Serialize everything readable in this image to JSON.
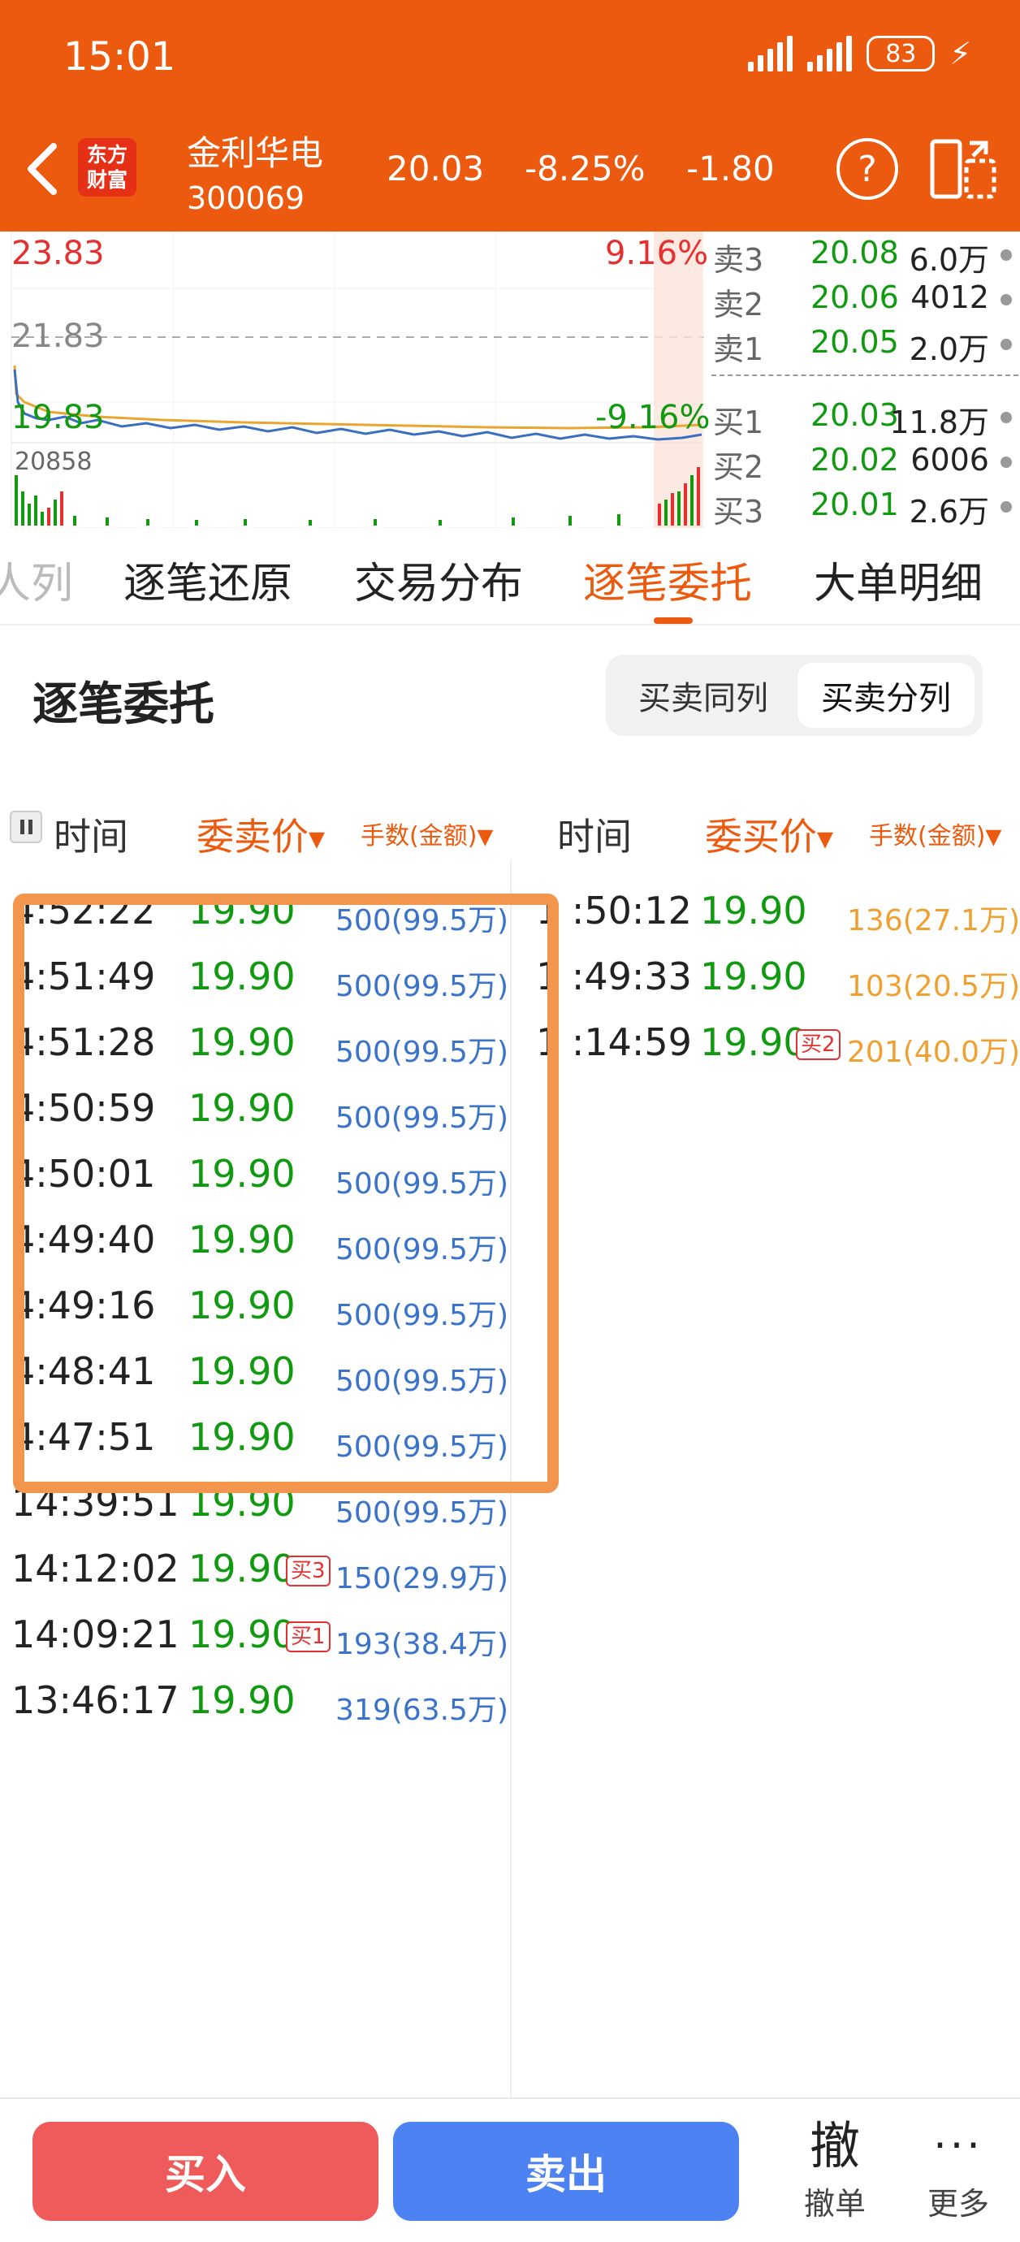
{
  "status_bar": {
    "time": "15:01",
    "battery": "83"
  },
  "header": {
    "logo_line1": "东方",
    "logo_line2": "财富",
    "stock_name": "金利华电",
    "stock_code": "300069",
    "price": "20.03",
    "change_pct": "-8.25%",
    "change": "-1.80",
    "help_label": "?"
  },
  "chart": {
    "high_label": "23.83",
    "mid_label": "21.83",
    "low_label": "19.83",
    "volume_label": "20858",
    "up_pct": "9.16%",
    "down_pct": "-9.16%"
  },
  "order_book": {
    "asks": [
      {
        "label": "卖3",
        "price": "20.08",
        "vol": "6.0万"
      },
      {
        "label": "卖2",
        "price": "20.06",
        "vol": "4012"
      },
      {
        "label": "卖1",
        "price": "20.05",
        "vol": "2.0万"
      }
    ],
    "bids": [
      {
        "label": "买1",
        "price": "20.03",
        "vol": "11.8万"
      },
      {
        "label": "买2",
        "price": "20.02",
        "vol": "6006"
      },
      {
        "label": "买3",
        "price": "20.01",
        "vol": "2.6万"
      }
    ]
  },
  "tabs": [
    "人列",
    "逐笔还原",
    "交易分布",
    "逐笔委托",
    "大单明细"
  ],
  "section": {
    "title": "逐笔委托",
    "toggle_same": "买卖同列",
    "toggle_split": "买卖分列"
  },
  "columns": {
    "sell_time": "时间",
    "sell_price": "委卖价",
    "sell_vol": "手数(金额)",
    "buy_time": "时间",
    "buy_price": "委买价",
    "buy_vol": "手数(金额)"
  },
  "sell_orders": [
    {
      "time": "4:52:22",
      "price": "19.90",
      "badge": "",
      "vol": "500(99.5万)"
    },
    {
      "time": "4:51:49",
      "price": "19.90",
      "badge": "",
      "vol": "500(99.5万)"
    },
    {
      "time": "4:51:28",
      "price": "19.90",
      "badge": "",
      "vol": "500(99.5万)"
    },
    {
      "time": "4:50:59",
      "price": "19.90",
      "badge": "",
      "vol": "500(99.5万)"
    },
    {
      "time": "4:50:01",
      "price": "19.90",
      "badge": "",
      "vol": "500(99.5万)"
    },
    {
      "time": "4:49:40",
      "price": "19.90",
      "badge": "",
      "vol": "500(99.5万)"
    },
    {
      "time": "4:49:16",
      "price": "19.90",
      "badge": "",
      "vol": "500(99.5万)"
    },
    {
      "time": "4:48:41",
      "price": "19.90",
      "badge": "",
      "vol": "500(99.5万)"
    },
    {
      "time": "4:47:51",
      "price": "19.90",
      "badge": "",
      "vol": "500(99.5万)"
    },
    {
      "time": "14:39:51",
      "price": "19.90",
      "badge": "",
      "vol": "500(99.5万)"
    },
    {
      "time": "14:12:02",
      "price": "19.90",
      "badge": "买3",
      "vol": "150(29.9万)"
    },
    {
      "time": "14:09:21",
      "price": "19.90",
      "badge": "买1",
      "vol": "193(38.4万)"
    },
    {
      "time": "13:46:17",
      "price": "19.90",
      "badge": "",
      "vol": "319(63.5万)"
    }
  ],
  "buy_orders": [
    {
      "time": "1 :50:12",
      "price": "19.90",
      "badge": "",
      "vol": "136(27.1万)"
    },
    {
      "time": "1 :49:33",
      "price": "19.90",
      "badge": "",
      "vol": "103(20.5万)"
    },
    {
      "time": "1 :14:59",
      "price": "19.90",
      "badge": "买2",
      "vol": "201(40.0万)"
    }
  ],
  "bottom": {
    "buy": "买入",
    "sell": "卖出",
    "cancel_glyph": "撤",
    "cancel_label": "撤单",
    "more_glyph": "···",
    "more_label": "更多"
  },
  "colors": {
    "brand_orange": "#EC5A0F",
    "up_red": "#E53030",
    "down_green": "#119911",
    "sell_volume_blue": "#3A73C9",
    "buy_volume_orange": "#F0A030",
    "highlight_box": "#F2954D"
  }
}
